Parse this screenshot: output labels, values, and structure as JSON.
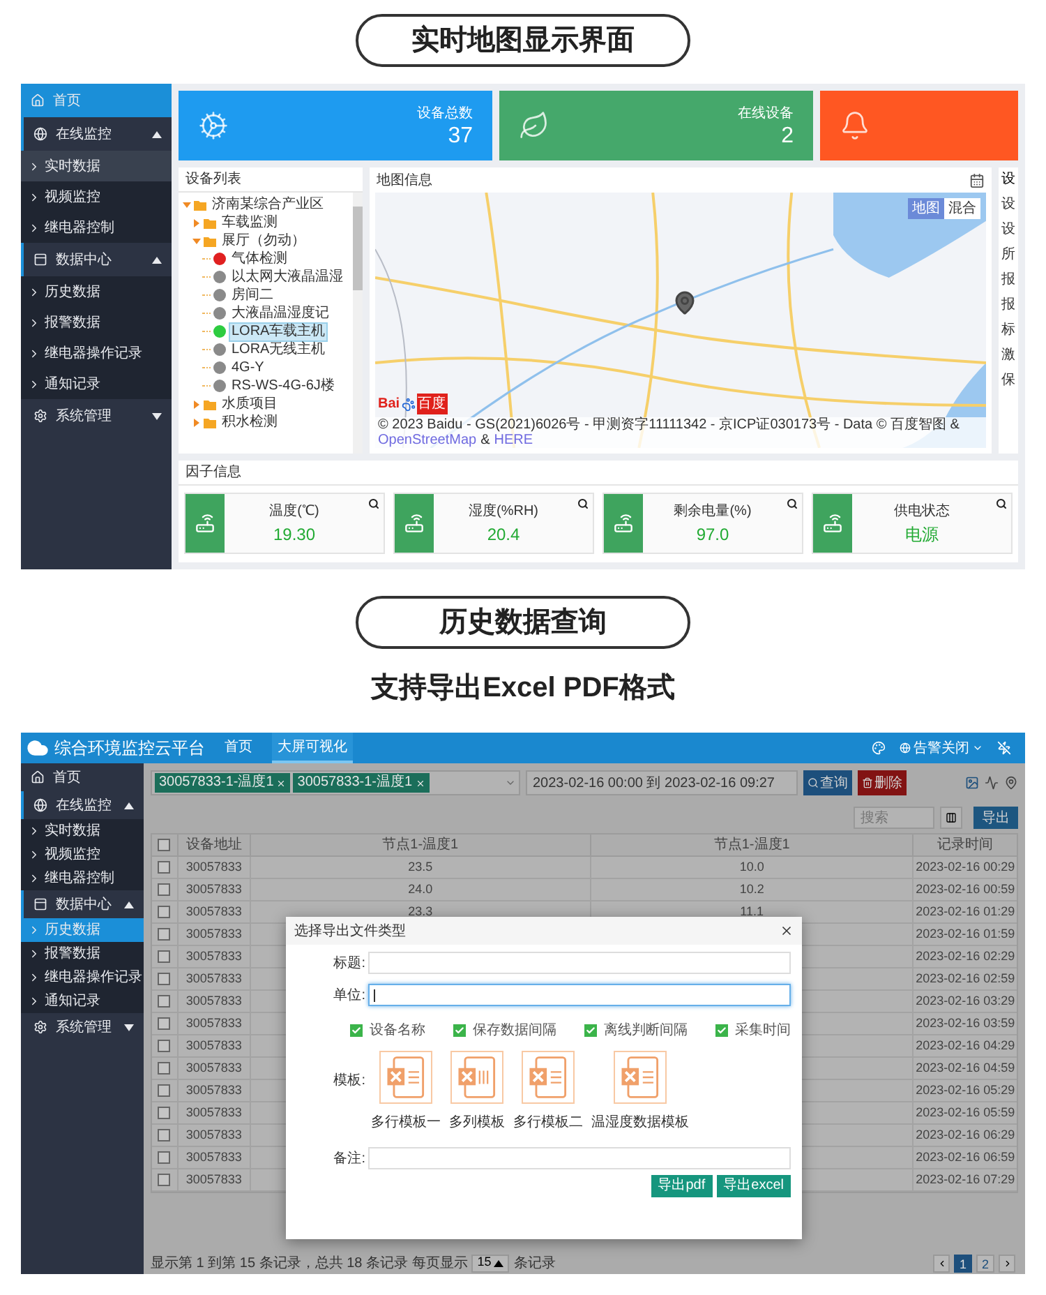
{
  "banner1": "实时地图显示界面",
  "screen1": {
    "sidebar": [
      {
        "label": "首页",
        "kind": "link",
        "selected": true
      },
      {
        "label": "在线监控",
        "kind": "group",
        "expanded": true,
        "children": [
          {
            "label": "实时数据",
            "selected": true
          },
          {
            "label": "视频监控",
            "selected": false
          },
          {
            "label": "继电器控制",
            "selected": false
          }
        ]
      },
      {
        "label": "数据中心",
        "kind": "group",
        "expanded": true,
        "children": [
          {
            "label": "历史数据",
            "selected": false
          },
          {
            "label": "报警数据",
            "selected": false
          },
          {
            "label": "继电器操作记录",
            "selected": false
          },
          {
            "label": "通知记录",
            "selected": false
          }
        ]
      },
      {
        "label": "系统管理",
        "kind": "group",
        "expanded": false
      }
    ],
    "stats": [
      {
        "label": "设备总数",
        "value": "37",
        "color": "#1e9bf0"
      },
      {
        "label": "在线设备",
        "value": "2",
        "color": "#45a86b"
      },
      {
        "color": "#ff5722"
      }
    ],
    "device_list": {
      "title": "设备列表",
      "tree": [
        {
          "label": "济南某综合产业区",
          "kind": "folder",
          "expanded": true,
          "children": [
            {
              "label": "车载监测",
              "kind": "folder",
              "expanded": false
            },
            {
              "label": "展厅（勿动）",
              "kind": "folder",
              "expanded": true,
              "children": [
                {
                  "label": "气体检测",
                  "kind": "device",
                  "color": "#e02020",
                  "selected": false
                },
                {
                  "label": "以太网大液晶温湿",
                  "kind": "device",
                  "color": "#8a8a8a",
                  "selected": false
                },
                {
                  "label": "房间二",
                  "kind": "device",
                  "color": "#8a8a8a",
                  "selected": false
                },
                {
                  "label": "大液晶温湿度记",
                  "kind": "device",
                  "color": "#8a8a8a",
                  "selected": false
                },
                {
                  "label": "LORA车载主机",
                  "kind": "device",
                  "color": "#2ecc40",
                  "selected": true
                },
                {
                  "label": "LORA无线主机",
                  "kind": "device",
                  "color": "#8a8a8a",
                  "selected": false
                },
                {
                  "label": "4G-Y",
                  "kind": "device",
                  "color": "#8a8a8a",
                  "selected": false
                },
                {
                  "label": "RS-WS-4G-6J楼",
                  "kind": "device",
                  "color": "#8a8a8a",
                  "selected": false
                }
              ]
            },
            {
              "label": "水质项目",
              "kind": "folder",
              "expanded": false
            },
            {
              "label": "积水检测",
              "kind": "folder",
              "expanded": false
            }
          ]
        }
      ]
    },
    "map": {
      "title": "地图信息",
      "map_types": [
        {
          "label": "地图",
          "selected": true
        },
        {
          "label": "混合",
          "selected": false
        }
      ],
      "logo": [
        "Bai",
        "百度"
      ],
      "attribution": "© 2023 Baidu - GS(2021)6026号 - 甲测资字11111342 - 京ICP证030173号 - Data © 百度智图 &",
      "links": [
        "OpenStreetMap",
        "HERE"
      ],
      "link_separator": "&"
    },
    "info_panel": {
      "title": "设",
      "rows": [
        "设",
        "设",
        "所",
        "报",
        "报",
        "标",
        "激",
        "保"
      ]
    },
    "factors": {
      "title": "因子信息",
      "items": [
        {
          "label": "温度(℃)",
          "value": "19.30"
        },
        {
          "label": "湿度(%RH)",
          "value": "20.4"
        },
        {
          "label": "剩余电量(%)",
          "value": "97.0"
        },
        {
          "label": "供电状态",
          "value": "电源"
        }
      ]
    }
  },
  "banner2": "历史数据查询",
  "subtitle": "支持导出Excel PDF格式",
  "screen2": {
    "header": {
      "title": "综合环境监控云平台",
      "nav": [
        {
          "label": "首页",
          "selected": false
        },
        {
          "label": "大屏可视化",
          "selected": true
        }
      ],
      "alarm": "告警关闭"
    },
    "sidebar": [
      {
        "label": "首页",
        "kind": "link",
        "selected": false
      },
      {
        "label": "在线监控",
        "kind": "group",
        "expanded": true,
        "children": [
          {
            "label": "实时数据",
            "selected": false
          },
          {
            "label": "视频监控",
            "selected": false
          },
          {
            "label": "继电器控制",
            "selected": false
          }
        ]
      },
      {
        "label": "数据中心",
        "kind": "group",
        "expanded": true,
        "children": [
          {
            "label": "历史数据",
            "selected": true
          },
          {
            "label": "报警数据",
            "selected": false
          },
          {
            "label": "继电器操作记录",
            "selected": false
          },
          {
            "label": "通知记录",
            "selected": false
          }
        ]
      },
      {
        "label": "系统管理",
        "kind": "group",
        "expanded": false
      }
    ],
    "filters": {
      "tags": [
        "30057833-1-温度1",
        "30057833-1-温度1"
      ],
      "date_range": "2023-02-16 00:00 到 2023-02-16 09:27",
      "query": "查询",
      "delete": "删除",
      "search_placeholder": "搜索",
      "export": "导出"
    },
    "table": {
      "header_checked": false,
      "columns": [
        "设备地址",
        "节点1-温度1",
        "节点1-温度1",
        "记录时间"
      ],
      "rows": [
        {
          "checked": false,
          "cells": [
            "30057833",
            "23.5",
            "10.0",
            "2023-02-16 00:29"
          ]
        },
        {
          "checked": false,
          "cells": [
            "30057833",
            "24.0",
            "10.2",
            "2023-02-16 00:59"
          ]
        },
        {
          "checked": false,
          "cells": [
            "30057833",
            "23.3",
            "11.1",
            "2023-02-16 01:29"
          ]
        },
        {
          "checked": false,
          "cells": [
            "30057833",
            null,
            null,
            "2023-02-16 01:59"
          ]
        },
        {
          "checked": false,
          "cells": [
            "30057833",
            null,
            null,
            "2023-02-16 02:29"
          ]
        },
        {
          "checked": false,
          "cells": [
            "30057833",
            null,
            null,
            "2023-02-16 02:59"
          ]
        },
        {
          "checked": false,
          "cells": [
            "30057833",
            null,
            null,
            "2023-02-16 03:29"
          ]
        },
        {
          "checked": false,
          "cells": [
            "30057833",
            null,
            null,
            "2023-02-16 03:59"
          ]
        },
        {
          "checked": false,
          "cells": [
            "30057833",
            null,
            null,
            "2023-02-16 04:29"
          ]
        },
        {
          "checked": false,
          "cells": [
            "30057833",
            null,
            null,
            "2023-02-16 04:59"
          ]
        },
        {
          "checked": false,
          "cells": [
            "30057833",
            null,
            null,
            "2023-02-16 05:29"
          ]
        },
        {
          "checked": false,
          "cells": [
            "30057833",
            null,
            null,
            "2023-02-16 05:59"
          ]
        },
        {
          "checked": false,
          "cells": [
            "30057833",
            null,
            null,
            "2023-02-16 06:29"
          ]
        },
        {
          "checked": false,
          "cells": [
            "30057833",
            null,
            null,
            "2023-02-16 06:59"
          ]
        },
        {
          "checked": false,
          "cells": [
            "30057833",
            null,
            null,
            "2023-02-16 07:29"
          ]
        }
      ]
    },
    "footer": {
      "summary": "显示第 1 到第 15 条记录，总共 18 条记录 每页显示",
      "page_size": "15",
      "page_size_suffix": "条记录",
      "pages": [
        {
          "label": "1",
          "selected": true
        },
        {
          "label": "2",
          "selected": false
        }
      ]
    },
    "dialog": {
      "title": "选择导出文件类型",
      "fields": [
        {
          "label": "标题:",
          "focused": false
        },
        {
          "label": "单位:",
          "focused": true
        }
      ],
      "options": [
        {
          "label": "设备名称",
          "checked": true
        },
        {
          "label": "保存数据间隔",
          "checked": true
        },
        {
          "label": "离线判断间隔",
          "checked": true
        },
        {
          "label": "采集时间",
          "checked": true
        }
      ],
      "template_label": "模板:",
      "templates": [
        {
          "label": "多行模板一",
          "kind": "rows"
        },
        {
          "label": "多列模板",
          "kind": "columns"
        },
        {
          "label": "多行模板二",
          "kind": "rows"
        },
        {
          "label": "温湿度数据模板",
          "kind": "rows"
        }
      ],
      "note_label": "备注:",
      "buttons": [
        "导出pdf",
        "导出excel"
      ]
    }
  }
}
